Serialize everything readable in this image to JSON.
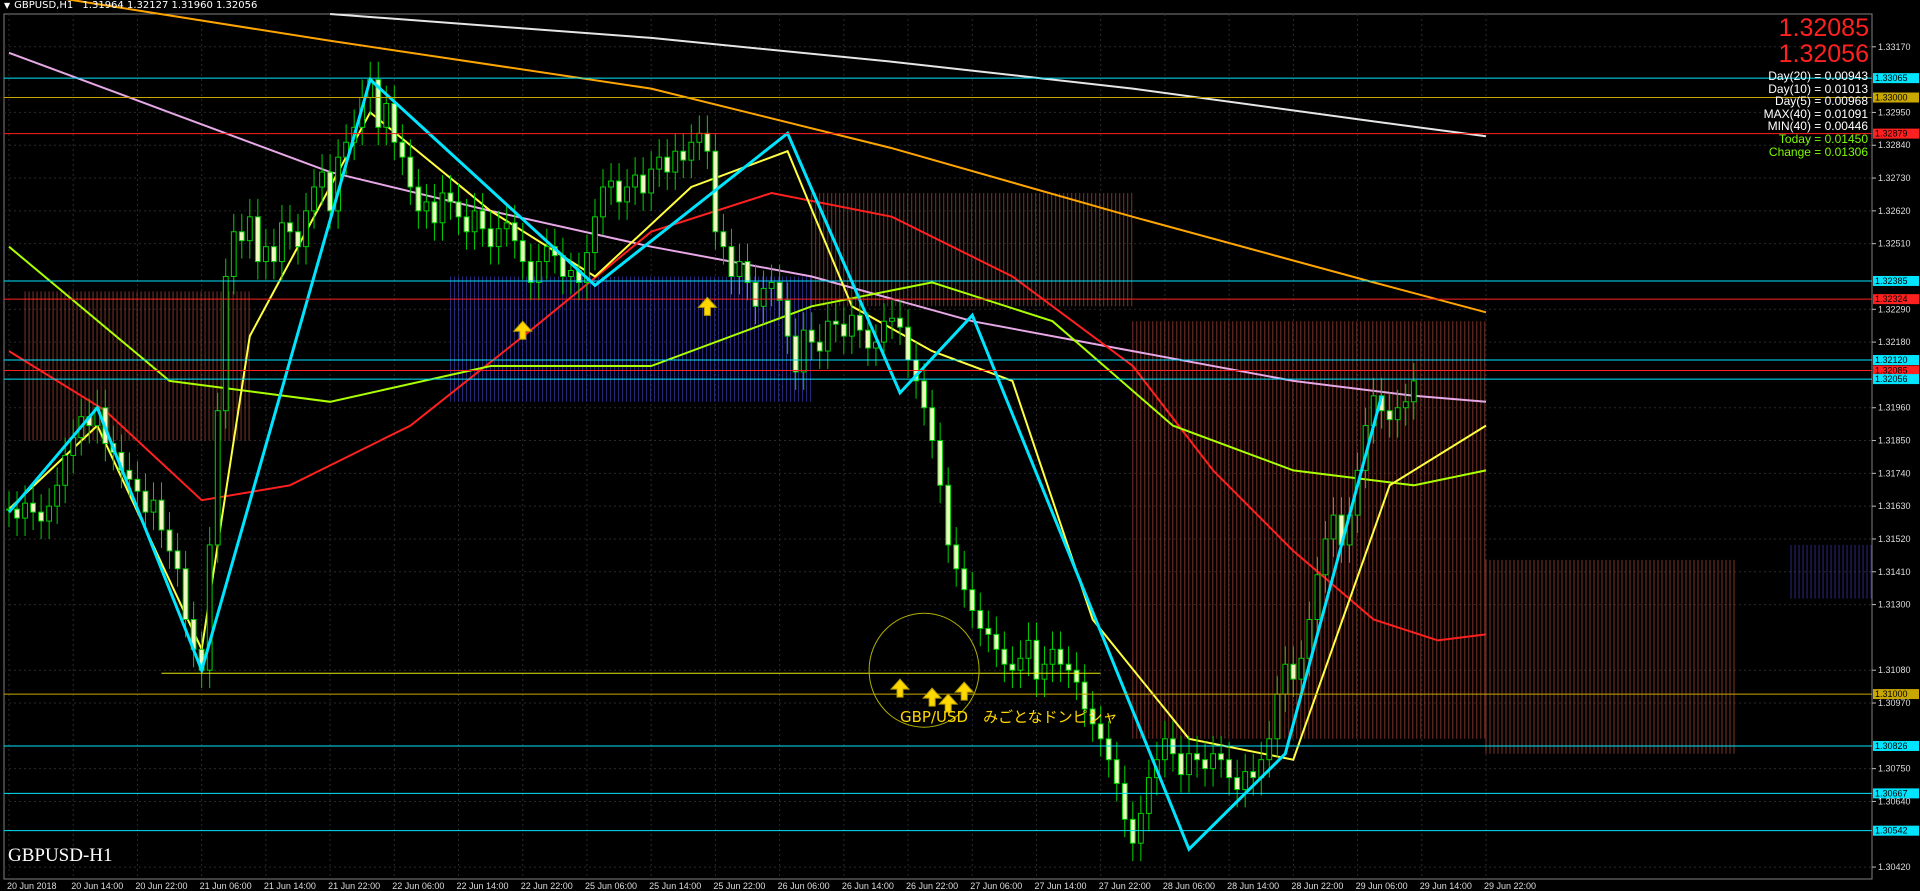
{
  "header": {
    "symbol": "GBPUSD,H1",
    "ohlc": "1.31964 1.32127 1.31960 1.32056"
  },
  "price_panel": {
    "bid": "1.32085",
    "ask": "1.32056"
  },
  "info_lines": [
    {
      "text": "Day(20) = 0.00943",
      "color": "#ffffff"
    },
    {
      "text": "Day(10) = 0.01013",
      "color": "#ffffff"
    },
    {
      "text": "Day(5) = 0.00968",
      "color": "#ffffff"
    },
    {
      "text": "MAX(40) = 0.01091",
      "color": "#ffffff"
    },
    {
      "text": "MIN(40) = 0.00446",
      "color": "#ffffff"
    },
    {
      "text": "Today = 0.01450",
      "color": "#7cfc00"
    },
    {
      "text": "Change = 0.01306",
      "color": "#7cfc00"
    }
  ],
  "watermark": "GBPUSD-H1",
  "annotation": "GBP/USD　みごとなドンピシャ",
  "colors": {
    "background": "#000000",
    "candle": "#00d000",
    "accent_cyan": "#00e5ff",
    "accent_red": "#ff2020",
    "accent_yellow": "#ffd800"
  },
  "chart_data": {
    "type": "line",
    "title": "",
    "xlabel": "",
    "ylabel": "",
    "ylim": [
      1.3038,
      1.3328
    ],
    "grid": true,
    "y_ticks": [
      "1.33170",
      "1.32950",
      "1.32840",
      "1.32730",
      "1.32620",
      "1.32510",
      "1.32290",
      "1.32180",
      "1.31960",
      "1.31850",
      "1.31740",
      "1.31630",
      "1.31520",
      "1.31410",
      "1.31300",
      "1.31080",
      "1.30970",
      "1.30750",
      "1.30640",
      "1.30420"
    ],
    "x_ticks": [
      {
        "label": "20 Jun 2018",
        "i": 0
      },
      {
        "label": "20 Jun 14:00",
        "i": 8
      },
      {
        "label": "20 Jun 22:00",
        "i": 16
      },
      {
        "label": "21 Jun 06:00",
        "i": 24
      },
      {
        "label": "21 Jun 14:00",
        "i": 32
      },
      {
        "label": "21 Jun 22:00",
        "i": 40
      },
      {
        "label": "22 Jun 06:00",
        "i": 48
      },
      {
        "label": "22 Jun 14:00",
        "i": 56
      },
      {
        "label": "22 Jun 22:00",
        "i": 64
      },
      {
        "label": "25 Jun 06:00",
        "i": 72
      },
      {
        "label": "25 Jun 14:00",
        "i": 80
      },
      {
        "label": "25 Jun 22:00",
        "i": 88
      },
      {
        "label": "26 Jun 06:00",
        "i": 96
      },
      {
        "label": "26 Jun 14:00",
        "i": 104
      },
      {
        "label": "26 Jun 22:00",
        "i": 112
      },
      {
        "label": "27 Jun 06:00",
        "i": 120
      },
      {
        "label": "27 Jun 14:00",
        "i": 128
      },
      {
        "label": "27 Jun 22:00",
        "i": 136
      },
      {
        "label": "28 Jun 06:00",
        "i": 144
      },
      {
        "label": "28 Jun 14:00",
        "i": 152
      },
      {
        "label": "28 Jun 22:00",
        "i": 160
      },
      {
        "label": "29 Jun 06:00",
        "i": 168
      },
      {
        "label": "29 Jun 14:00",
        "i": 176
      },
      {
        "label": "29 Jun 22:00",
        "i": 184
      }
    ],
    "level_lines": [
      {
        "label": "1.33065",
        "value": 1.33065,
        "color": "#00e5ff"
      },
      {
        "label": "1.33000",
        "value": 1.33,
        "color": "#c8a800"
      },
      {
        "label": "1.32879",
        "value": 1.32879,
        "color": "#ff2020"
      },
      {
        "label": "1.32385",
        "value": 1.32385,
        "color": "#00e5ff"
      },
      {
        "label": "1.32324",
        "value": 1.32324,
        "color": "#ff2020"
      },
      {
        "label": "1.32120",
        "value": 1.3212,
        "color": "#00e5ff"
      },
      {
        "label": "1.32085",
        "value": 1.32085,
        "color": "#ff2020"
      },
      {
        "label": "1.32056",
        "value": 1.32056,
        "color": "#00e5ff"
      },
      {
        "label": "1.31000",
        "value": 1.31,
        "color": "#c8a800"
      },
      {
        "label": "1.30826",
        "value": 1.30826,
        "color": "#00e5ff"
      },
      {
        "label": "1.30667",
        "value": 1.30667,
        "color": "#00e5ff"
      },
      {
        "label": "1.30542",
        "value": 1.30542,
        "color": "#00e5ff"
      }
    ],
    "zigzag": [
      [
        0,
        1.3161
      ],
      [
        11,
        1.3196
      ],
      [
        24,
        1.3108
      ],
      [
        45,
        1.3306
      ],
      [
        73,
        1.3237
      ],
      [
        97,
        1.3288
      ],
      [
        111,
        1.3201
      ],
      [
        120,
        1.3227
      ],
      [
        147,
        1.3048
      ],
      [
        159,
        1.308
      ],
      [
        171,
        1.32
      ]
    ],
    "support_line": {
      "value": 1.3107,
      "i_start": 19,
      "i_end": 136
    },
    "buy_arrows": [
      {
        "i": 64,
        "value": 1.3225
      },
      {
        "i": 87,
        "value": 1.3233
      },
      {
        "i": 111,
        "value": 1.3105
      },
      {
        "i": 115,
        "value": 1.3102
      },
      {
        "i": 117,
        "value": 1.31
      },
      {
        "i": 119,
        "value": 1.3104
      }
    ],
    "close_series": [
      1.3162,
      1.3159,
      1.3164,
      1.3161,
      1.3158,
      1.3163,
      1.317,
      1.318,
      1.3186,
      1.3193,
      1.319,
      1.3196,
      1.3184,
      1.3181,
      1.3175,
      1.3172,
      1.3168,
      1.3161,
      1.3165,
      1.3155,
      1.3148,
      1.3142,
      1.3125,
      1.3115,
      1.3108,
      1.315,
      1.3195,
      1.324,
      1.3255,
      1.3252,
      1.326,
      1.3245,
      1.325,
      1.3245,
      1.3258,
      1.3255,
      1.325,
      1.3262,
      1.327,
      1.3275,
      1.3262,
      1.328,
      1.3285,
      1.329,
      1.33,
      1.3306,
      1.329,
      1.3298,
      1.3285,
      1.328,
      1.327,
      1.3262,
      1.3265,
      1.3258,
      1.3268,
      1.3265,
      1.326,
      1.3255,
      1.3262,
      1.3256,
      1.325,
      1.3256,
      1.3258,
      1.3252,
      1.3245,
      1.3238,
      1.3245,
      1.325,
      1.3247,
      1.324,
      1.3242,
      1.3238,
      1.3248,
      1.326,
      1.327,
      1.3272,
      1.3265,
      1.327,
      1.3274,
      1.3268,
      1.3276,
      1.328,
      1.3275,
      1.3282,
      1.3279,
      1.3285,
      1.3288,
      1.3282,
      1.3255,
      1.325,
      1.324,
      1.3245,
      1.3238,
      1.323,
      1.3236,
      1.3238,
      1.3232,
      1.322,
      1.3208,
      1.3222,
      1.3218,
      1.3215,
      1.3225,
      1.3224,
      1.322,
      1.3227,
      1.3222,
      1.3216,
      1.3218,
      1.3225,
      1.3226,
      1.3223,
      1.3212,
      1.3205,
      1.3196,
      1.3185,
      1.317,
      1.315,
      1.3142,
      1.3135,
      1.3128,
      1.3122,
      1.312,
      1.3115,
      1.311,
      1.3108,
      1.3112,
      1.3118,
      1.3105,
      1.311,
      1.3115,
      1.311,
      1.3108,
      1.3104,
      1.3095,
      1.309,
      1.3085,
      1.3078,
      1.307,
      1.3058,
      1.305,
      1.306,
      1.3072,
      1.3078,
      1.3085,
      1.308,
      1.3073,
      1.308,
      1.3078,
      1.3075,
      1.308,
      1.3078,
      1.3072,
      1.3068,
      1.3074,
      1.3072,
      1.3078,
      1.3085,
      1.31,
      1.311,
      1.3105,
      1.3112,
      1.3125,
      1.314,
      1.3152,
      1.316,
      1.315,
      1.316,
      1.3175,
      1.319,
      1.32,
      1.3195,
      1.3192,
      1.3196,
      1.3198,
      1.3205
    ],
    "series": [
      {
        "color": "#ffa500",
        "values": [
          [
            0,
            1.3336
          ],
          [
            40,
            1.3319
          ],
          [
            80,
            1.3303
          ],
          [
            110,
            1.3283
          ],
          [
            140,
            1.326
          ],
          [
            170,
            1.3238
          ],
          [
            184,
            1.3228
          ]
        ]
      },
      {
        "color": "#e6e6e6",
        "values": [
          [
            40,
            1.3328
          ],
          [
            80,
            1.332
          ],
          [
            110,
            1.3312
          ],
          [
            140,
            1.3303
          ],
          [
            170,
            1.3292
          ],
          [
            184,
            1.3287
          ]
        ]
      },
      {
        "color": "#e6a8e6",
        "values": [
          [
            0,
            1.3315
          ],
          [
            20,
            1.3295
          ],
          [
            40,
            1.3275
          ],
          [
            60,
            1.3262
          ],
          [
            80,
            1.325
          ],
          [
            100,
            1.324
          ],
          [
            120,
            1.3225
          ],
          [
            140,
            1.3215
          ],
          [
            160,
            1.3205
          ],
          [
            175,
            1.32
          ],
          [
            184,
            1.3198
          ]
        ]
      },
      {
        "color": "#ff2020",
        "values": [
          [
            0,
            1.3215
          ],
          [
            12,
            1.3195
          ],
          [
            24,
            1.3165
          ],
          [
            35,
            1.317
          ],
          [
            50,
            1.319
          ],
          [
            65,
            1.3222
          ],
          [
            80,
            1.3255
          ],
          [
            95,
            1.3268
          ],
          [
            110,
            1.326
          ],
          [
            125,
            1.324
          ],
          [
            140,
            1.321
          ],
          [
            150,
            1.3175
          ],
          [
            160,
            1.3148
          ],
          [
            170,
            1.3125
          ],
          [
            178,
            1.3118
          ],
          [
            184,
            1.312
          ]
        ]
      },
      {
        "color": "#aaff00",
        "values": [
          [
            0,
            1.325
          ],
          [
            20,
            1.3205
          ],
          [
            40,
            1.3198
          ],
          [
            60,
            1.321
          ],
          [
            80,
            1.321
          ],
          [
            100,
            1.323
          ],
          [
            115,
            1.3238
          ],
          [
            130,
            1.3225
          ],
          [
            145,
            1.319
          ],
          [
            160,
            1.3175
          ],
          [
            175,
            1.317
          ],
          [
            184,
            1.3175
          ]
        ]
      },
      {
        "color": "#ffff40",
        "values": [
          [
            0,
            1.3162
          ],
          [
            11,
            1.319
          ],
          [
            24,
            1.3115
          ],
          [
            30,
            1.322
          ],
          [
            45,
            1.3295
          ],
          [
            60,
            1.3262
          ],
          [
            73,
            1.324
          ],
          [
            85,
            1.327
          ],
          [
            97,
            1.3282
          ],
          [
            105,
            1.323
          ],
          [
            115,
            1.3215
          ],
          [
            125,
            1.3205
          ],
          [
            135,
            1.3125
          ],
          [
            147,
            1.3085
          ],
          [
            160,
            1.3078
          ],
          [
            172,
            1.317
          ],
          [
            184,
            1.319
          ]
        ]
      }
    ]
  }
}
